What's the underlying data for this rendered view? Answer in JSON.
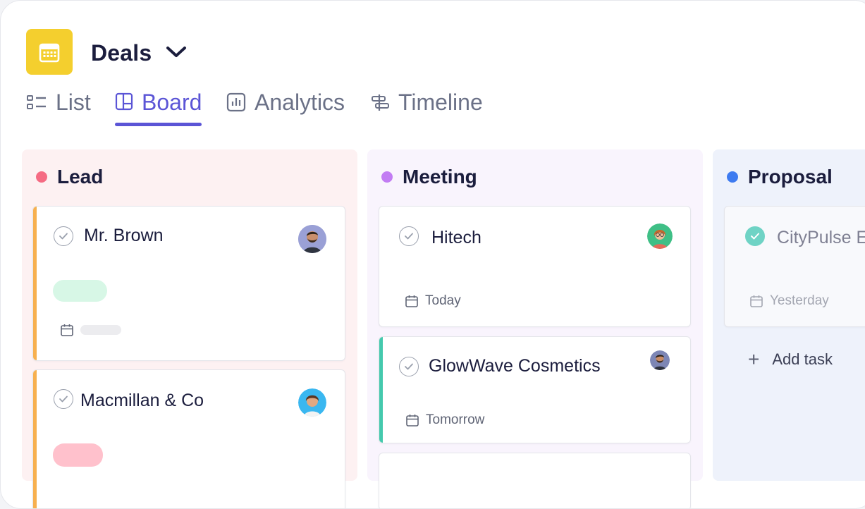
{
  "header": {
    "title": "Deals",
    "app_icon": "calendar-icon",
    "brand_color": "#f4cf2e"
  },
  "tabs": [
    {
      "label": "List",
      "icon": "list-icon",
      "active": false
    },
    {
      "label": "Board",
      "icon": "board-icon",
      "active": true
    },
    {
      "label": "Analytics",
      "icon": "analytics-icon",
      "active": false
    },
    {
      "label": "Timeline",
      "icon": "timeline-icon",
      "active": false
    }
  ],
  "accent_color": "#5b55d6",
  "columns": {
    "lead": {
      "title": "Lead",
      "dot_color": "#f56b83",
      "cards": [
        {
          "title": "Mr. Brown",
          "due": "",
          "tag_color": "#d7f7e6",
          "stripe_color": "#f7b04f"
        },
        {
          "title": "Macmillan & Co",
          "due": "",
          "tag_color": "#ffc1cc",
          "stripe_color": "#f7b04f"
        }
      ]
    },
    "meeting": {
      "title": "Meeting",
      "dot_color": "#c27cf3",
      "cards": [
        {
          "title": "Hitech",
          "due": "Today"
        },
        {
          "title": "GlowWave Cosmetics",
          "due": "Tomorrow",
          "stripe_color": "#44c9ad"
        }
      ]
    },
    "proposal": {
      "title": "Proposal",
      "dot_color": "#3d7bf0",
      "cards": [
        {
          "title": "CityPulse Ev",
          "due": "Yesterday",
          "completed": true
        }
      ],
      "add_task_label": "Add task"
    }
  }
}
